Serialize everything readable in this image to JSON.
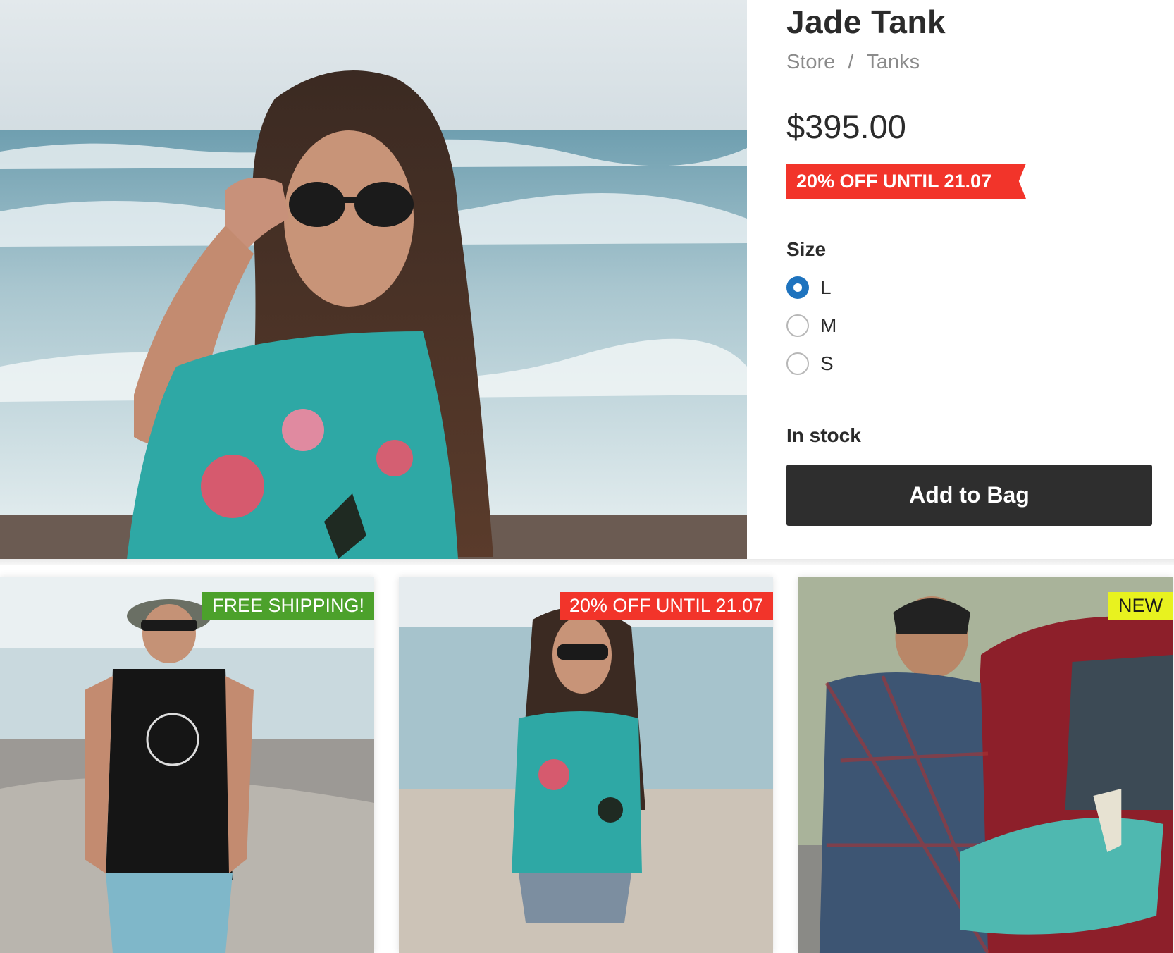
{
  "product": {
    "title": "Jade Tank",
    "breadcrumb": [
      "Store",
      "Tanks"
    ],
    "breadcrumb_separator": "/",
    "price": "$395.00",
    "promo": "20% OFF UNTIL 21.07",
    "size_label": "Size",
    "sizes": [
      {
        "label": "L",
        "selected": true
      },
      {
        "label": "M",
        "selected": false
      },
      {
        "label": "S",
        "selected": false
      }
    ],
    "stock_status": "In stock",
    "add_to_bag_label": "Add to Bag"
  },
  "related": [
    {
      "badge": "FREE SHIPPING!",
      "badge_color": "#4ca12b"
    },
    {
      "badge": "20% OFF UNTIL 21.07",
      "badge_color": "#f2342a"
    },
    {
      "badge": "NEW",
      "badge_color": "#e8f21f"
    }
  ],
  "colors": {
    "promo_red": "#f2342a",
    "radio_selected": "#1e73be",
    "button_dark": "#2e2e2e"
  }
}
